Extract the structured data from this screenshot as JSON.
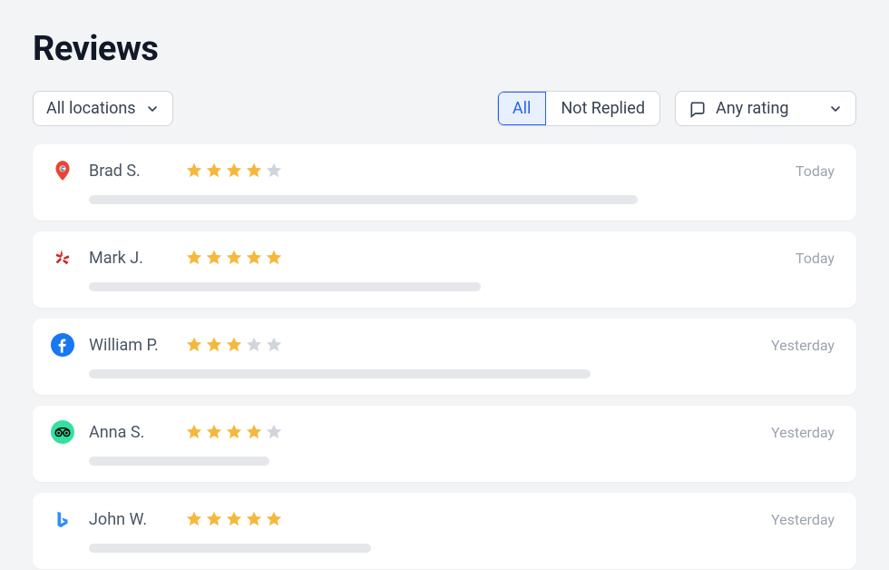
{
  "page": {
    "title": "Reviews"
  },
  "filters": {
    "location_label": "All locations",
    "segments": {
      "all": "All",
      "not_replied": "Not Replied",
      "active": "all"
    },
    "rating_label": "Any rating"
  },
  "colors": {
    "star_filled": "#f5b83d",
    "star_empty": "#d1d5db"
  },
  "reviews": [
    {
      "source": "google",
      "name": "Brad S.",
      "rating": 4,
      "time": "Today",
      "body_width": 70
    },
    {
      "source": "yelp",
      "name": "Mark J.",
      "rating": 5,
      "time": "Today",
      "body_width": 50
    },
    {
      "source": "facebook",
      "name": "William P.",
      "rating": 3,
      "time": "Yesterday",
      "body_width": 64
    },
    {
      "source": "tripadvisor",
      "name": "Anna S.",
      "rating": 4,
      "time": "Yesterday",
      "body_width": 23
    },
    {
      "source": "bing",
      "name": "John W.",
      "rating": 5,
      "time": "Yesterday",
      "body_width": 36
    }
  ]
}
